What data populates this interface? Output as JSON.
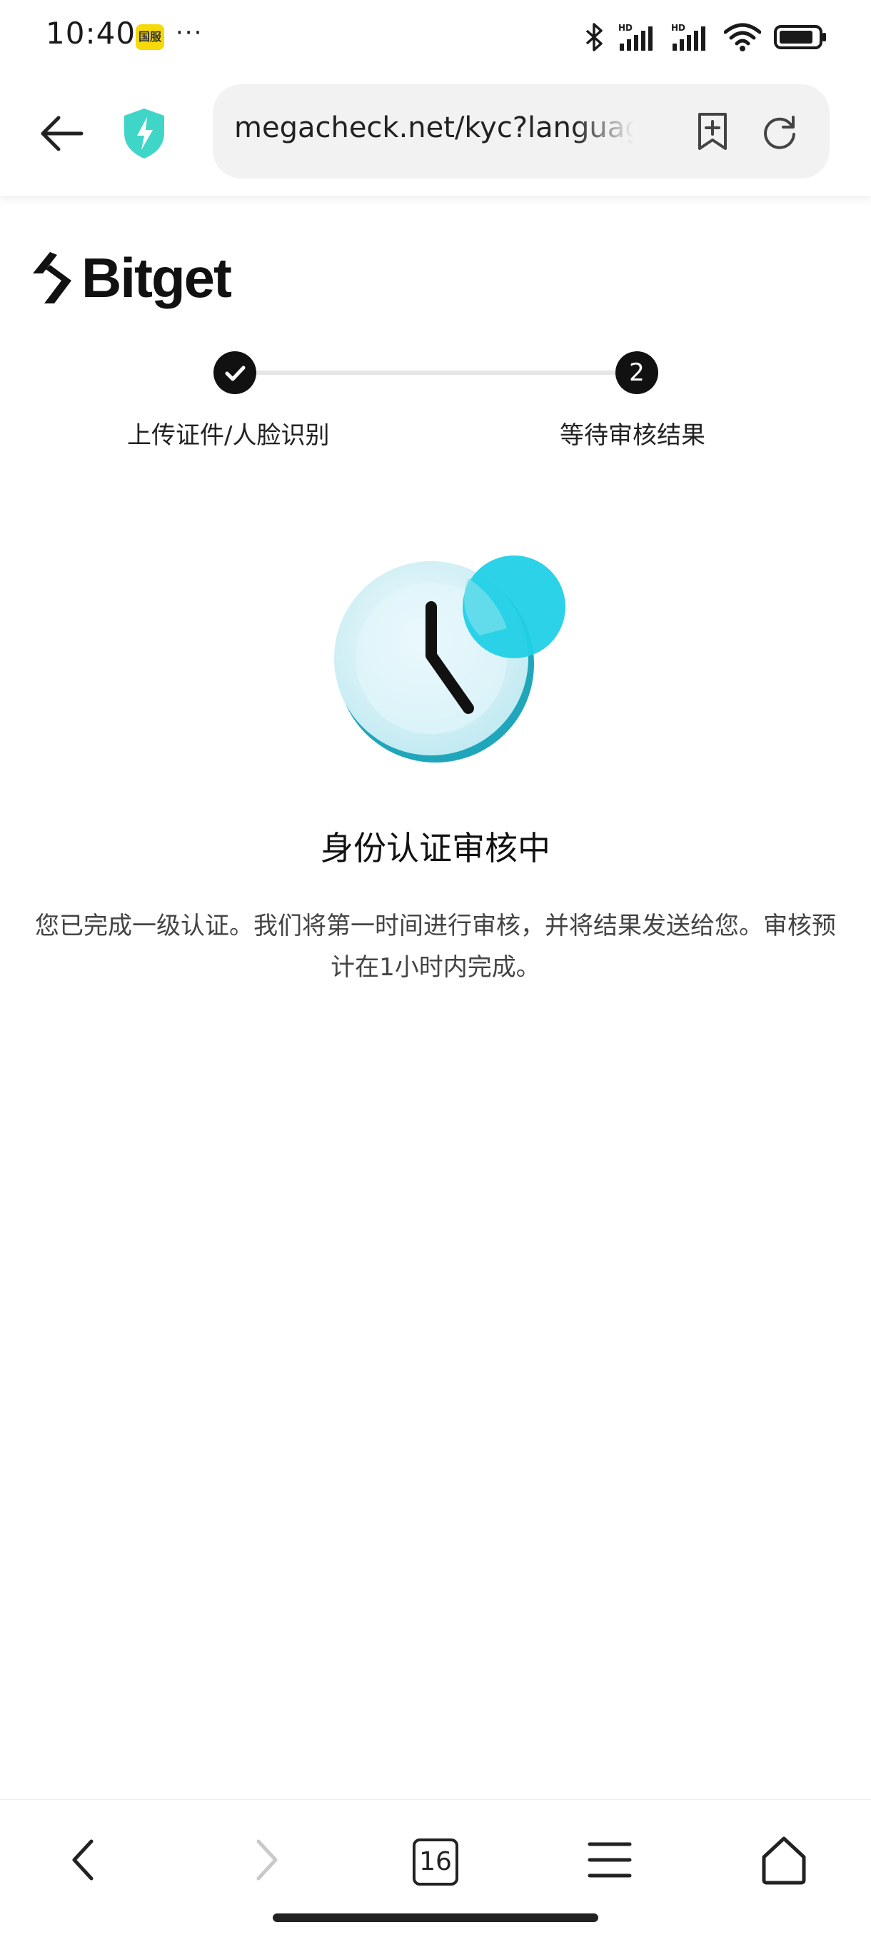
{
  "status_bar": {
    "time": "10:40",
    "badge_text": "国服",
    "more_dots": "···",
    "icons": [
      "bluetooth-icon",
      "signal-hd-icon",
      "signal-hd-icon",
      "wifi-icon",
      "battery-icon"
    ]
  },
  "browser": {
    "url": "megacheck.net/kyc?language",
    "icons": [
      "back-arrow-icon",
      "shield-bolt-icon",
      "bookmark-add-icon",
      "reload-icon"
    ]
  },
  "brand": {
    "logo_text": "Bitget"
  },
  "stepper": {
    "steps": [
      {
        "label": "上传证件/人脸识别",
        "state": "done"
      },
      {
        "label": "等待审核结果",
        "number": "2",
        "state": "current"
      }
    ]
  },
  "main": {
    "title": "身份认证审核中",
    "description": "您已完成一级认证。我们将第一时间进行审核，并将结果发送给您。审核预计在1小时内完成。",
    "illustration": "clock-icon",
    "accent_color": "#21d0e6"
  },
  "bottom_nav": {
    "tab_count": "16",
    "icons": [
      "chevron-left-icon",
      "chevron-right-icon",
      "tabs-icon",
      "menu-icon",
      "home-icon"
    ]
  }
}
